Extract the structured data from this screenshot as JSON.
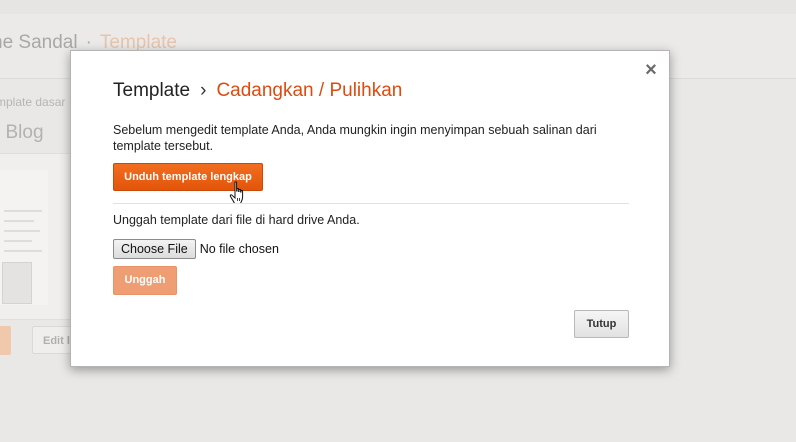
{
  "background": {
    "title_prefix": "ne Sandal",
    "title_sep": "·",
    "title_current": "Template",
    "subtitle": "mplate dasar",
    "blog_label": "i Blog",
    "edit_button": "Edit l"
  },
  "modal": {
    "breadcrumb_root": "Template",
    "breadcrumb_sep": "›",
    "breadcrumb_current": "Cadangkan / Pulihkan",
    "close_symbol": "×",
    "description": "Sebelum mengedit template Anda, Anda mungkin ingin menyimpan sebuah salinan dari template tersebut.",
    "download_button": "Unduh template lengkap",
    "upload_instruction": "Unggah template dari file di hard drive Anda.",
    "choose_file_button": "Choose File",
    "no_file_text": "No file chosen",
    "upload_button": "Unggah",
    "close_button": "Tutup"
  },
  "colors": {
    "accent": "#dd4b0f",
    "primary_button": "#e2550b",
    "disabled_button": "#ef9d72"
  },
  "icons": {
    "close": "close-icon",
    "cursor": "hand-pointer-icon"
  }
}
